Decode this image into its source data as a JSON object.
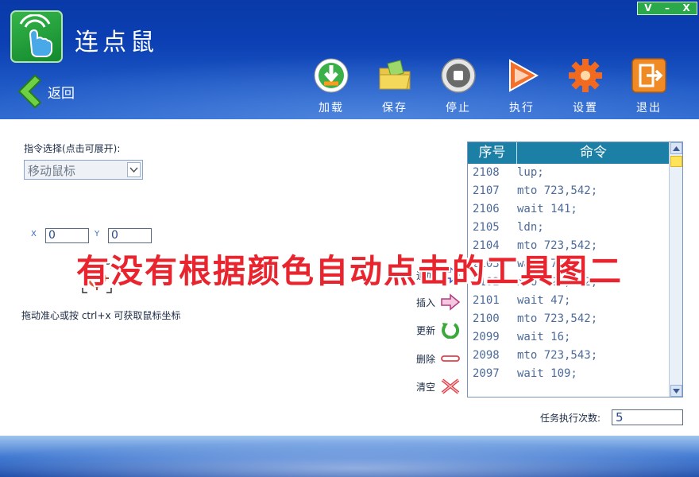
{
  "window": {
    "controls": [
      "V",
      "–",
      "X"
    ]
  },
  "app": {
    "title": "连点鼠",
    "back_label": "返回"
  },
  "toolbar": [
    {
      "label": "加载",
      "icon": "load-icon"
    },
    {
      "label": "保存",
      "icon": "save-folder-icon"
    },
    {
      "label": "停止",
      "icon": "stop-icon"
    },
    {
      "label": "执行",
      "icon": "play-icon"
    },
    {
      "label": "设置",
      "icon": "gear-icon"
    },
    {
      "label": "退出",
      "icon": "exit-icon"
    }
  ],
  "command": {
    "label": "指令选择(点击可展开):",
    "selected": "移动鼠标"
  },
  "coords": {
    "x_label": "X",
    "x_value": "0",
    "y_label": "Y",
    "y_value": "0"
  },
  "drag_hint": "拖动准心或按 ctrl+x 可获取鼠标坐标",
  "actions": [
    {
      "label": "追加",
      "icon": "append-arrow-icon"
    },
    {
      "label": "插入",
      "icon": "insert-arrow-icon"
    },
    {
      "label": "更新",
      "icon": "refresh-icon"
    },
    {
      "label": "删除",
      "icon": "minus-icon"
    },
    {
      "label": "清空",
      "icon": "clear-x-icon"
    }
  ],
  "list": {
    "headers": [
      "序号",
      "命令"
    ],
    "rows": [
      [
        "2108",
        "lup;"
      ],
      [
        "2107",
        "mto 723,542;"
      ],
      [
        "2106",
        "wait 141;"
      ],
      [
        "2105",
        "ldn;"
      ],
      [
        "2104",
        "mto 723,542;"
      ],
      [
        "2103",
        "wait 73;"
      ],
      [
        "2102",
        "mto 723,542;"
      ],
      [
        "2101",
        "wait 47;"
      ],
      [
        "2100",
        "mto 723,542;"
      ],
      [
        "2099",
        "wait 16;"
      ],
      [
        "2098",
        "mto 723,543;"
      ],
      [
        "2097",
        "wait 109;"
      ]
    ]
  },
  "task": {
    "label": "任务执行次数:",
    "value": "5"
  },
  "overlay_caption": "有没有根据颜色自动点击的工具图二",
  "colors": {
    "header": "#0b3fb3",
    "list_header": "#1c7fa6",
    "caption": "#e8252e"
  }
}
